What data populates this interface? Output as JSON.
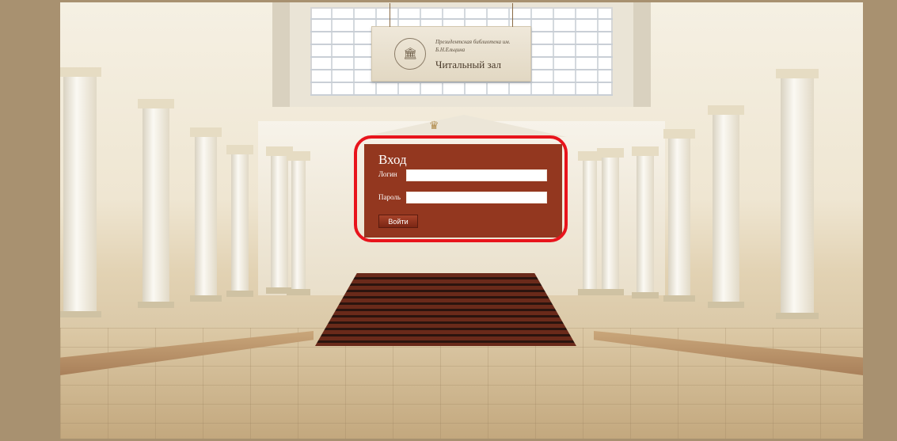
{
  "sign": {
    "library_name": "Президентская библиотека им. Б.Н.Ельцина",
    "room_title": "Читальный зал"
  },
  "login": {
    "title": "Вход",
    "login_label": "Логин",
    "login_value": "",
    "password_label": "Пароль",
    "password_value": "",
    "submit_label": "Войти"
  },
  "colors": {
    "panel": "#93371f",
    "highlight": "#e8141c",
    "frame": "#a89170"
  }
}
